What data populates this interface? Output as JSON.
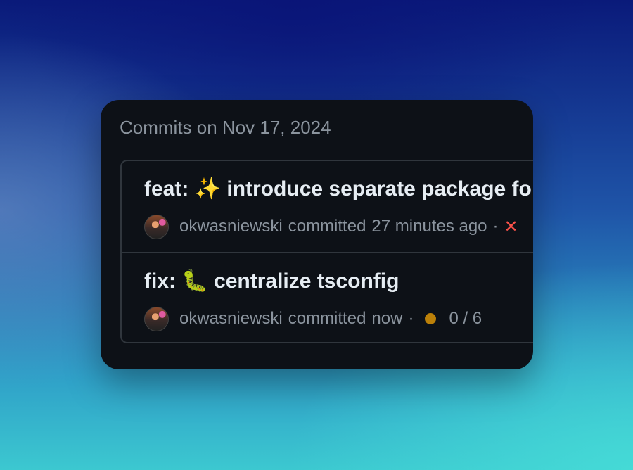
{
  "header": {
    "title": "Commits on Nov 17, 2024"
  },
  "commits": [
    {
      "prefix": "feat:",
      "emoji": "✨",
      "message": "introduce separate package fo",
      "author": "okwasniewski",
      "action": "committed",
      "time": "27 minutes ago",
      "separator": "·",
      "status_icon": "✕",
      "status": "failure"
    },
    {
      "prefix": "fix:",
      "emoji": "🐛",
      "message": "centralize tsconfig",
      "author": "okwasniewski",
      "action": "committed",
      "time": "now",
      "separator": "·",
      "status": "pending",
      "checks": "0 / 6"
    }
  ],
  "colors": {
    "card_background": "#0d1117",
    "failure": "#f85149",
    "pending": "#bb8009",
    "muted_text": "#8b949e",
    "title_text": "#e6edf3"
  }
}
